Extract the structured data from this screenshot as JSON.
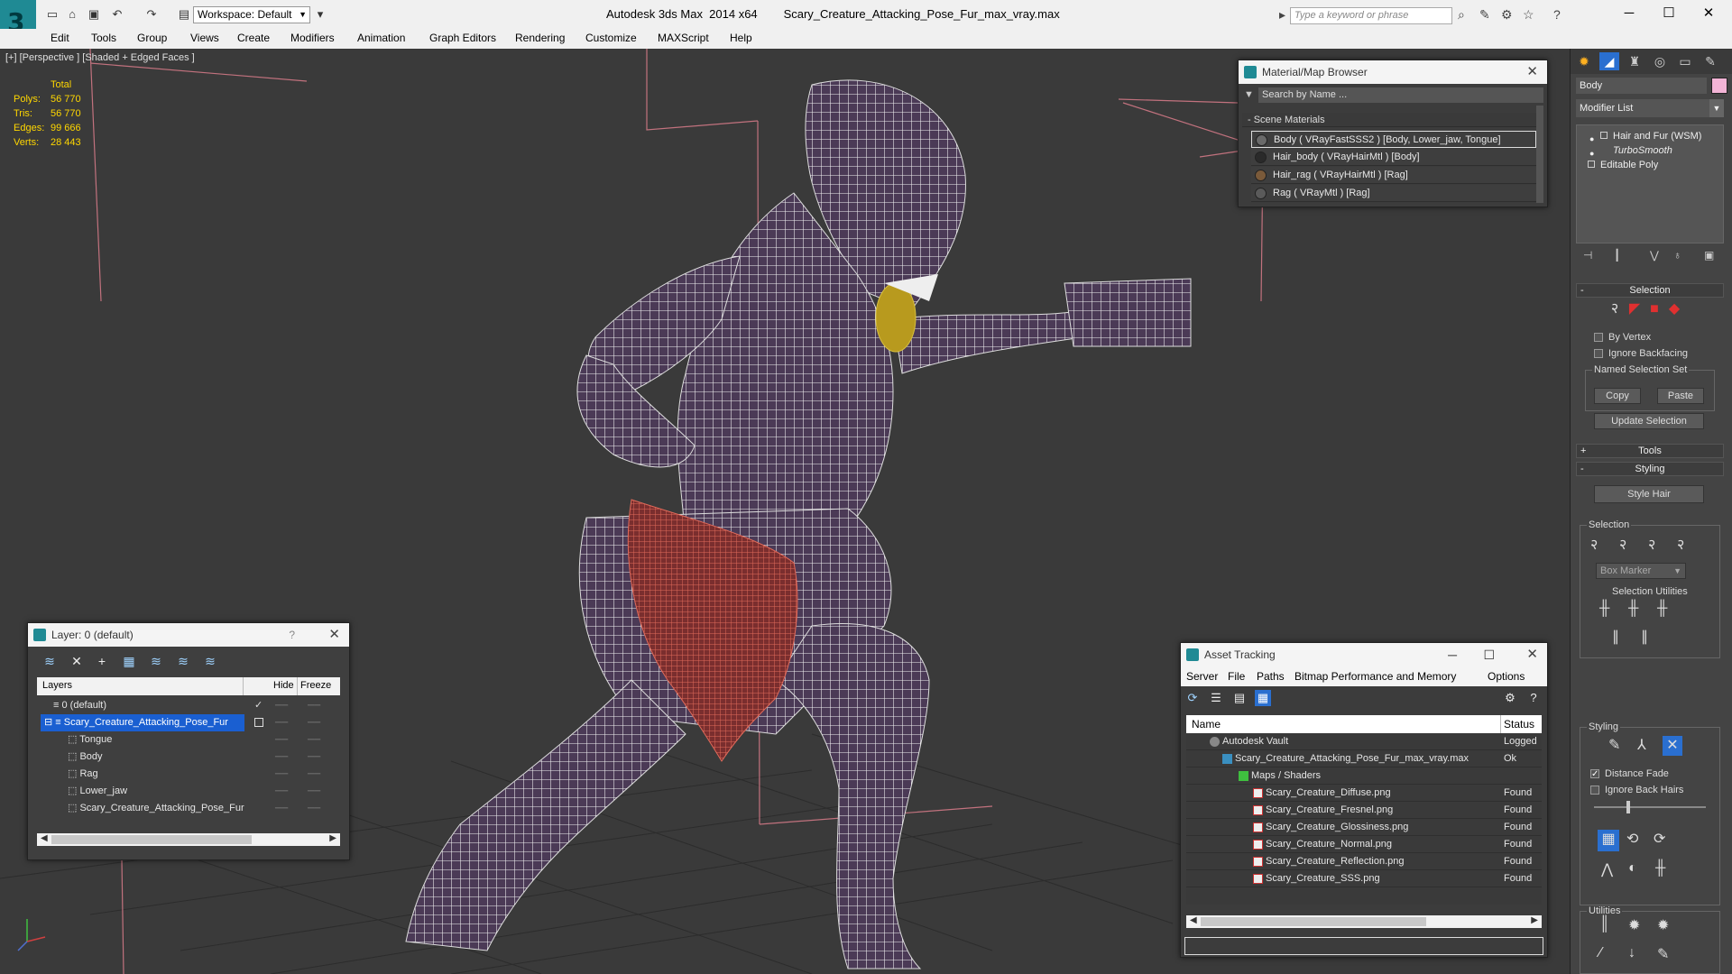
{
  "titlebar": {
    "app_title": "Autodesk 3ds Max  2014 x64",
    "file_name": "Scary_Creature_Attacking_Pose_Fur_max_vray.max",
    "workspace": "Workspace: Default",
    "search_placeholder": "Type a keyword or phrase"
  },
  "menu": [
    "Edit",
    "Tools",
    "Group",
    "Views",
    "Create",
    "Modifiers",
    "Animation",
    "Graph Editors",
    "Rendering",
    "Customize",
    "MAXScript",
    "Help"
  ],
  "viewport": {
    "label": "[+] [Perspective ] [Shaded + Edged Faces ]",
    "stats": {
      "header": "Total",
      "rows": [
        {
          "key": "Polys:",
          "value": "56 770"
        },
        {
          "key": "Tris:",
          "value": "56 770"
        },
        {
          "key": "Edges:",
          "value": "99 666"
        },
        {
          "key": "Verts:",
          "value": "28 443"
        }
      ]
    }
  },
  "material_browser": {
    "title": "Material/Map Browser",
    "search": "Search by Name ...",
    "section": "- Scene Materials",
    "items": [
      {
        "label": "Body  ( VRayFastSSS2 ) [Body, Lower_jaw, Tongue]",
        "color": "#6a6a6a"
      },
      {
        "label": "Hair_body  ( VRayHairMtl ) [Body]",
        "color": "#2a2a2a"
      },
      {
        "label": "Hair_rag  ( VRayHairMtl ) [Rag]",
        "color": "#7a5a3a"
      },
      {
        "label": "Rag  ( VRayMtl ) [Rag]",
        "color": "#5a5a5a"
      }
    ]
  },
  "layer_panel": {
    "title": "Layer: 0 (default)",
    "help": "?",
    "columns": {
      "layers": "Layers",
      "hide": "Hide",
      "freeze": "Freeze"
    },
    "rows": [
      {
        "name": "0 (default)",
        "indent": 0
      },
      {
        "name": "Scary_Creature_Attacking_Pose_Fur",
        "indent": 0
      },
      {
        "name": "Tongue",
        "indent": 1
      },
      {
        "name": "Body",
        "indent": 1
      },
      {
        "name": "Rag",
        "indent": 1
      },
      {
        "name": "Lower_jaw",
        "indent": 1
      },
      {
        "name": "Scary_Creature_Attacking_Pose_Fur",
        "indent": 1
      }
    ]
  },
  "asset_tracking": {
    "title": "Asset Tracking",
    "menu": [
      "Server",
      "File",
      "Paths",
      "Bitmap Performance and Memory",
      "Options"
    ],
    "columns": {
      "name": "Name",
      "status": "Status"
    },
    "rows": [
      {
        "name": "Autodesk Vault",
        "status": "Logged Out",
        "indent": 1
      },
      {
        "name": "Scary_Creature_Attacking_Pose_Fur_max_vray.max",
        "status": "Ok",
        "indent": 2
      },
      {
        "name": "Maps / Shaders",
        "status": "",
        "indent": 3
      },
      {
        "name": "Scary_Creature_Diffuse.png",
        "status": "Found",
        "indent": 4
      },
      {
        "name": "Scary_Creature_Fresnel.png",
        "status": "Found",
        "indent": 4
      },
      {
        "name": "Scary_Creature_Glossiness.png",
        "status": "Found",
        "indent": 4
      },
      {
        "name": "Scary_Creature_Normal.png",
        "status": "Found",
        "indent": 4
      },
      {
        "name": "Scary_Creature_Reflection.png",
        "status": "Found",
        "indent": 4
      },
      {
        "name": "Scary_Creature_SSS.png",
        "status": "Found",
        "indent": 4
      }
    ]
  },
  "command_panel": {
    "object_name": "Body",
    "object_color": "#f3b4d6",
    "modifier_list": "Modifier List",
    "stack": [
      "Hair and Fur (WSM)",
      "TurboSmooth",
      "Editable Poly"
    ],
    "selection_rollout": "Selection",
    "by_vertex": "By Vertex",
    "ignore_backfacing": "Ignore Backfacing",
    "named_selection_set": "Named Selection Set",
    "copy": "Copy",
    "paste": "Paste",
    "update_selection": "Update Selection",
    "tools_rollout": "Tools",
    "styling_rollout": "Styling",
    "style_hair": "Style Hair",
    "selection_group": "Selection",
    "box_marker": "Box Marker",
    "selection_utilities": "Selection Utilities",
    "styling_group": "Styling",
    "distance_fade": "Distance Fade",
    "ignore_back_hairs": "Ignore Back Hairs",
    "utilities_group": "Utilities"
  }
}
